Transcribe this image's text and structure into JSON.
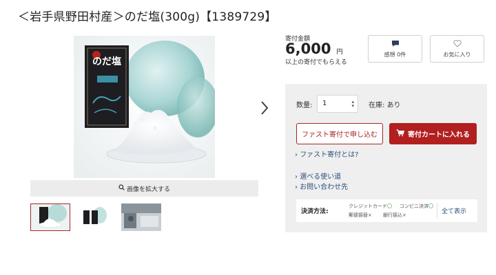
{
  "product": {
    "title": "＜岩手県野田村産＞のだ塩(300g)【1389729】"
  },
  "gallery": {
    "zoom_label": "画像を拡大する",
    "package_text": "のだ塩"
  },
  "price": {
    "label": "寄付金額",
    "value": "6,000",
    "unit": "円",
    "note": "以上の寄付でもらえる"
  },
  "actions": {
    "review_label": "感想 0件",
    "favorite_label": "お気に入り"
  },
  "order": {
    "quantity_label": "数量:",
    "quantity_value": "1",
    "stock_label": "在庫:",
    "stock_value": "あり",
    "fast_button": "ファスト寄付で申し込む",
    "cart_button": "寄付カートに入れる"
  },
  "links": {
    "fast_info": "ファスト寄付とは?",
    "usage": "選べる使い道",
    "contact": "お問い合わせ先"
  },
  "payment": {
    "label": "決済方法:",
    "methods": [
      {
        "name": "クレジットカード",
        "mark": "〇"
      },
      {
        "name": "コンビニ決済",
        "mark": "〇"
      },
      {
        "name": "郵便振替",
        "mark": "×"
      },
      {
        "name": "銀行振込",
        "mark": "×"
      }
    ],
    "show_all": "全て表示"
  },
  "colors": {
    "accent": "#b21f1f",
    "link": "#2d4f7c",
    "available": "#3a9a3a"
  }
}
